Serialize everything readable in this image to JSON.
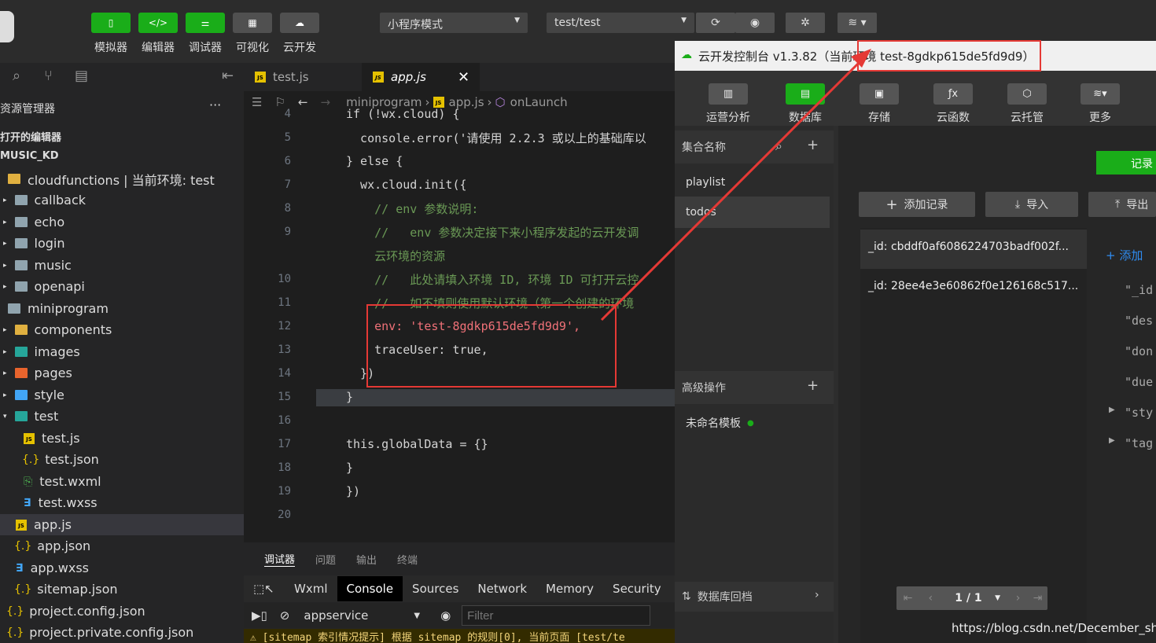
{
  "toolbar": {
    "buttons": [
      {
        "label": "模拟器",
        "icon": "phone-icon"
      },
      {
        "label": "编辑器",
        "icon": "code-icon"
      },
      {
        "label": "调试器",
        "icon": "sliders-icon"
      },
      {
        "label": "可视化",
        "icon": "layout-icon"
      },
      {
        "label": "云开发",
        "icon": "cloud-icon"
      }
    ],
    "mode_select": "小程序模式",
    "compile_select": "test/test"
  },
  "explorer": {
    "title": "资源管理器",
    "open_editors": "打开的编辑器",
    "project": "MUSIC_KD",
    "items": [
      {
        "label": "cloudfunctions | 当前环境: test",
        "icon": "folder-open-icon"
      },
      {
        "label": "callback",
        "icon": "folder-icon"
      },
      {
        "label": "echo",
        "icon": "folder-icon"
      },
      {
        "label": "login",
        "icon": "folder-icon"
      },
      {
        "label": "music",
        "icon": "folder-icon"
      },
      {
        "label": "openapi",
        "icon": "folder-icon"
      },
      {
        "label": "miniprogram",
        "icon": "folder-open-icon"
      },
      {
        "label": "components",
        "icon": "folder-icon"
      },
      {
        "label": "images",
        "icon": "folder-icon"
      },
      {
        "label": "pages",
        "icon": "folder-icon"
      },
      {
        "label": "style",
        "icon": "folder-icon"
      },
      {
        "label": "test",
        "icon": "folder-icon"
      },
      {
        "label": "test.js",
        "icon": "js-file-icon"
      },
      {
        "label": "test.json",
        "icon": "json-file-icon"
      },
      {
        "label": "test.wxml",
        "icon": "wxml-file-icon"
      },
      {
        "label": "test.wxss",
        "icon": "css-file-icon"
      },
      {
        "label": "app.js",
        "icon": "js-file-icon"
      },
      {
        "label": "app.json",
        "icon": "json-file-icon"
      },
      {
        "label": "app.wxss",
        "icon": "css-file-icon"
      },
      {
        "label": "sitemap.json",
        "icon": "json-file-icon"
      },
      {
        "label": "project.config.json",
        "icon": "json-file-icon"
      },
      {
        "label": "project.private.config.json",
        "icon": "json-file-icon"
      }
    ]
  },
  "editor": {
    "tabs": [
      "test.js",
      "app.js"
    ],
    "breadcrumb": [
      "miniprogram",
      "app.js",
      "onLaunch"
    ],
    "lines": [
      {
        "n": "4",
        "text": "if (!wx.cloud) {"
      },
      {
        "n": "5",
        "text": "  console.error('请使用 2.2.3 或以上的基础库以"
      },
      {
        "n": "6",
        "text": "} else {"
      },
      {
        "n": "7",
        "text": "  wx.cloud.init({"
      },
      {
        "n": "8",
        "text": "    // env 参数说明:"
      },
      {
        "n": "9",
        "text": "    //   env 参数决定接下来小程序发起的云开发调"
      },
      {
        "n": "",
        "text": "    云环境的资源"
      },
      {
        "n": "10",
        "text": "    //   此处请填入环境 ID, 环境 ID 可打开云控"
      },
      {
        "n": "11",
        "text": "    //   如不填则使用默认环境（第一个创建的环境"
      },
      {
        "n": "12",
        "text": "    env: 'test-8gdkp615de5fd9d9',"
      },
      {
        "n": "13",
        "text": "    traceUser: true,"
      },
      {
        "n": "14",
        "text": "  })"
      },
      {
        "n": "15",
        "text": "}"
      },
      {
        "n": "16",
        "text": ""
      },
      {
        "n": "17",
        "text": "this.globalData = {}"
      },
      {
        "n": "18",
        "text": "}"
      },
      {
        "n": "19",
        "text": "})"
      },
      {
        "n": "20",
        "text": ""
      }
    ]
  },
  "devtools": {
    "panel_tabs": [
      "调试器",
      "问题",
      "输出",
      "终端"
    ],
    "tool_tabs": [
      "Wxml",
      "Console",
      "Sources",
      "Network",
      "Memory",
      "Security"
    ],
    "context": "appservice",
    "filter_placeholder": "Filter",
    "warning": "[sitemap 索引情况提示] 根据 sitemap 的规则[0], 当前页面 [test/te"
  },
  "cloud": {
    "title": "云开发控制台 v1.3.82（当前环境 test-8gdkp615de5fd9d9）",
    "nav": [
      "运营分析",
      "数据库",
      "存储",
      "云函数",
      "云托管",
      "更多"
    ],
    "collection_header": "集合名称",
    "collections": [
      "playlist",
      "todos"
    ],
    "advanced_header": "高级操作",
    "template": "未命名模板",
    "rollback": "数据库回档",
    "record_button": "记录",
    "add_record": "添加记录",
    "import": "导入",
    "export": "导出",
    "records": [
      "_id: cbddf0af6086224703badf002f...",
      "_id: 28ee4e3e60862f0e126168c517..."
    ],
    "add_field": "添加",
    "fields": [
      "\"_id",
      "\"des",
      "\"don",
      "\"due",
      "\"sty",
      "\"tag"
    ],
    "pagination": "1 / 1"
  },
  "watermark": "https://blog.csdn.net/December_shi"
}
